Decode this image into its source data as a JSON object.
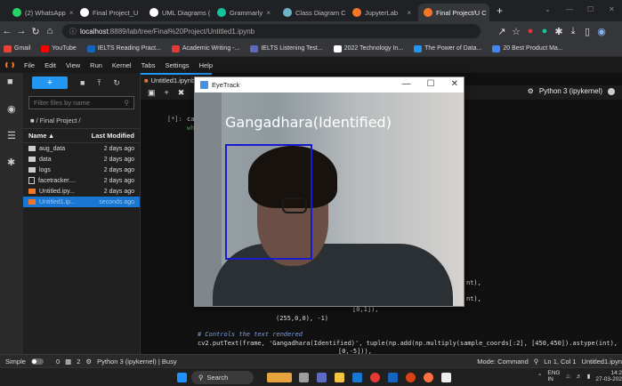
{
  "browser": {
    "tabs": [
      {
        "label": "(2) WhatsApp",
        "color": "#25d366"
      },
      {
        "label": "Final Project_U",
        "color": "#ffffff"
      },
      {
        "label": "UML Diagrams (",
        "color": "#ffffff"
      },
      {
        "label": "Grammarly",
        "color": "#15c39a"
      },
      {
        "label": "Class Diagram C",
        "color": "#6fb3c6"
      },
      {
        "label": "JupyterLab",
        "color": "#f37726"
      },
      {
        "label": "Final Project/U C",
        "color": "#f37726"
      }
    ],
    "new_tab": "+",
    "url_host": "localhost",
    "url_rest": ":8889/lab/tree/Final%20Project/Untitled1.ipynb",
    "bookmarks": [
      {
        "label": "Gmail",
        "color": "#ea4335"
      },
      {
        "label": "YouTube",
        "color": "#ff0000"
      },
      {
        "label": "IELTS Reading Pract...",
        "color": "#1565c0"
      },
      {
        "label": "Academic Writing -...",
        "color": "#e53935"
      },
      {
        "label": "IELTS Listening Test...",
        "color": "#5c6bc0"
      },
      {
        "label": "2022 Technology In...",
        "color": "#ffffff"
      },
      {
        "label": "The Power of Data...",
        "color": "#2196f3"
      },
      {
        "label": "20 Best Product Ma...",
        "color": "#4285f4"
      }
    ]
  },
  "menu": [
    "File",
    "Edit",
    "View",
    "Run",
    "Kernel",
    "Tabs",
    "Settings",
    "Help"
  ],
  "filebrowser": {
    "filter_placeholder": "Filter files by name",
    "path": "/ Final Project /",
    "col_name": "Name",
    "col_modified": "Last Modified",
    "files": [
      {
        "name": "aug_data",
        "modified": "2 days ago",
        "type": "folder"
      },
      {
        "name": "data",
        "modified": "2 days ago",
        "type": "folder"
      },
      {
        "name": "logs",
        "modified": "2 days ago",
        "type": "folder"
      },
      {
        "name": "facetracker....",
        "modified": "2 days ago",
        "type": "file"
      },
      {
        "name": "Untitled.ipy...",
        "modified": "2 days ago",
        "type": "notebook"
      },
      {
        "name": "Untitled1.ip...",
        "modified": "seconds ago",
        "type": "notebook"
      }
    ]
  },
  "notebook": {
    "tab_label": "Untitled1.ipynb",
    "kernel": "Python 3 (ipykernel)",
    "prompt": "[*]:",
    "code_top": [
      "cap",
      "whi"
    ],
    "code_right": [
      "nt),",
      "nt),"
    ],
    "code_lines": [
      "[0,1]),",
      "(255,0,0), -1)"
    ],
    "comment": "# Controls the text rendered",
    "code_put": "cv2.putText(frame, 'Gangadhara(Identified)', tuple(np.add(np.multiply(sample_coords[:2], [450,450]).astype(int),",
    "code_last": "[0,-5])),"
  },
  "eyetrack": {
    "title": "EyeTrack",
    "label": "Gangadhara(Identified)",
    "min": "—",
    "max": "☐",
    "close": "✕"
  },
  "status": {
    "mode": "Simple",
    "count1": "0",
    "count2": "2",
    "kernel_state": "Python 3 (ipykernel) | Busy",
    "command": "Mode: Command",
    "position": "Ln 1, Col 1",
    "file": "Untitled1.ipyn"
  },
  "taskbar": {
    "search": "Search",
    "lang": "ENG",
    "region": "IN",
    "time": "14:2",
    "date": "27-03-202"
  }
}
